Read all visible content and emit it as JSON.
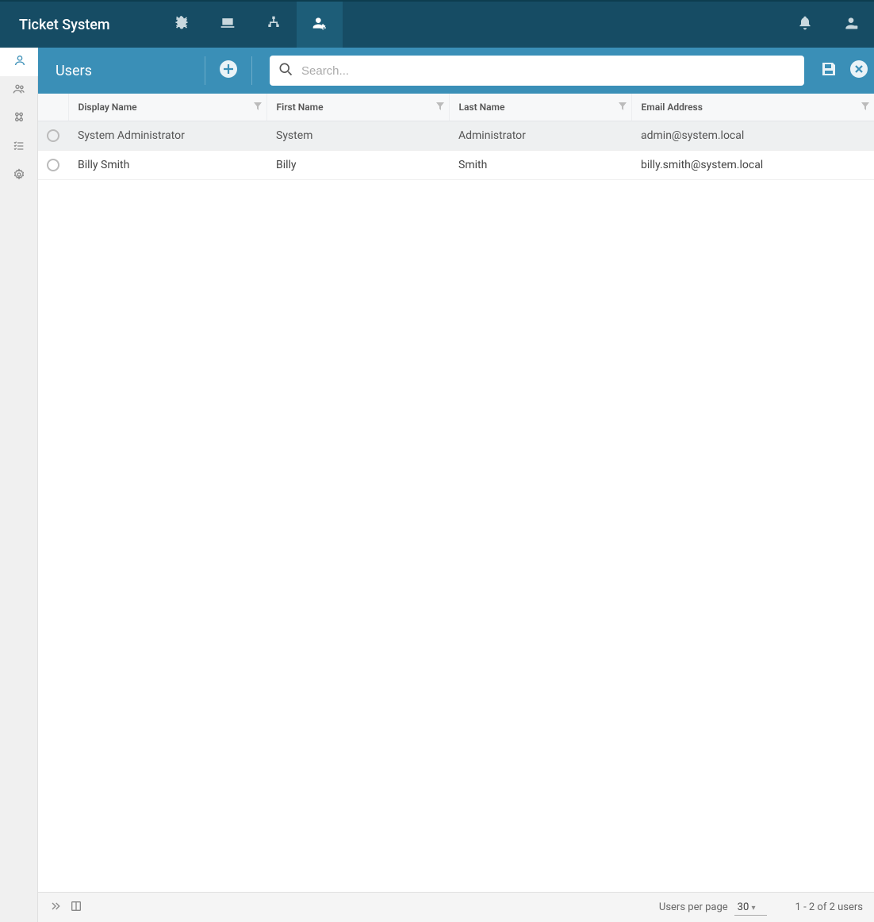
{
  "app": {
    "title": "Ticket System"
  },
  "page": {
    "title": "Users"
  },
  "search": {
    "placeholder": "Search..."
  },
  "columns": {
    "display_name": "Display Name",
    "first_name": "First Name",
    "last_name": "Last Name",
    "email": "Email Address"
  },
  "rows": [
    {
      "display_name": "System Administrator",
      "first_name": "System",
      "last_name": "Administrator",
      "email": "admin@system.local"
    },
    {
      "display_name": "Billy Smith",
      "first_name": "Billy",
      "last_name": "Smith",
      "email": "billy.smith@system.local"
    }
  ],
  "footer": {
    "per_page_label": "Users per page",
    "per_page_value": "30",
    "range_text": "1 - 2 of 2 users"
  }
}
